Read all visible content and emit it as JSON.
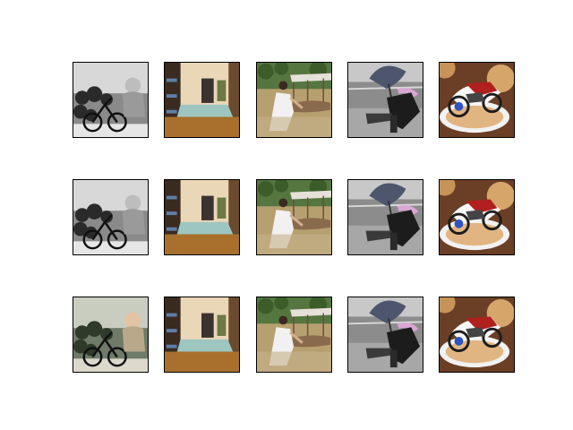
{
  "figure": {
    "background": "#ffffff",
    "rows": 3,
    "cols": 5,
    "panels": [
      {
        "row": 0,
        "col": 0,
        "subject": "baby-on-bicycle",
        "grayscale": true
      },
      {
        "row": 0,
        "col": 1,
        "subject": "room-interior",
        "grayscale": false
      },
      {
        "row": 0,
        "col": 2,
        "subject": "woman-by-boat",
        "grayscale": false
      },
      {
        "row": 0,
        "col": 3,
        "subject": "person-with-umbrella",
        "grayscale": false
      },
      {
        "row": 0,
        "col": 4,
        "subject": "motorcycle-food-plate",
        "grayscale": false
      },
      {
        "row": 1,
        "col": 0,
        "subject": "baby-on-bicycle",
        "grayscale": true
      },
      {
        "row": 1,
        "col": 1,
        "subject": "room-interior",
        "grayscale": false
      },
      {
        "row": 1,
        "col": 2,
        "subject": "woman-by-boat",
        "grayscale": false
      },
      {
        "row": 1,
        "col": 3,
        "subject": "person-with-umbrella",
        "grayscale": false
      },
      {
        "row": 1,
        "col": 4,
        "subject": "motorcycle-food-plate",
        "grayscale": false
      },
      {
        "row": 2,
        "col": 0,
        "subject": "baby-on-bicycle",
        "grayscale": false
      },
      {
        "row": 2,
        "col": 1,
        "subject": "room-interior",
        "grayscale": false
      },
      {
        "row": 2,
        "col": 2,
        "subject": "woman-by-boat",
        "grayscale": false
      },
      {
        "row": 2,
        "col": 3,
        "subject": "person-with-umbrella",
        "grayscale": false
      },
      {
        "row": 2,
        "col": 4,
        "subject": "motorcycle-food-plate",
        "grayscale": false
      }
    ]
  }
}
